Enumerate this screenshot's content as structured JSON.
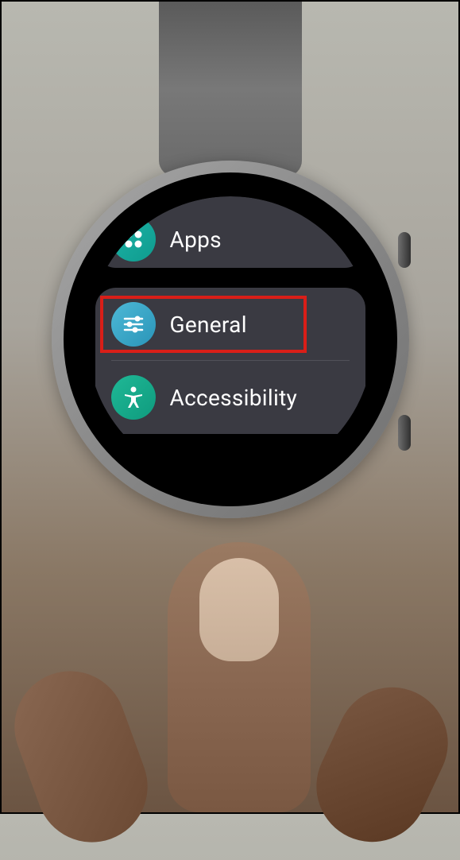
{
  "settings": {
    "items": [
      {
        "label": "Apps",
        "icon": "apps-icon",
        "icon_color": "#1db5a8"
      },
      {
        "label": "General",
        "icon": "sliders-icon",
        "icon_color": "#4db8d6",
        "highlighted": true
      },
      {
        "label": "Accessibility",
        "icon": "accessibility-icon",
        "icon_color": "#1fb896"
      }
    ]
  },
  "highlight": {
    "target": "general-item"
  }
}
